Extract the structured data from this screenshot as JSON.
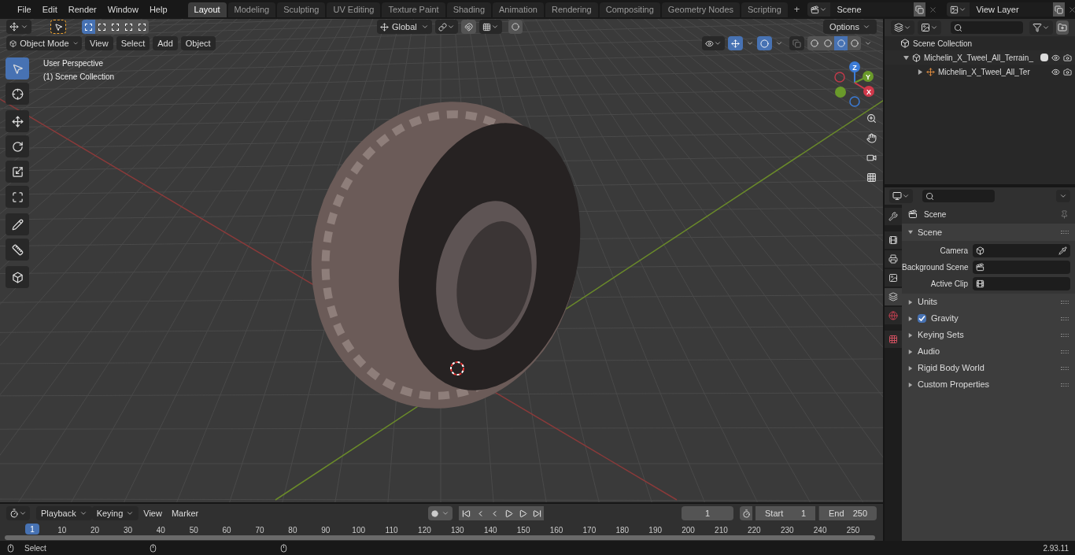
{
  "menu": [
    "File",
    "Edit",
    "Render",
    "Window",
    "Help"
  ],
  "workspaces": [
    {
      "label": "Layout",
      "selected": true
    },
    {
      "label": "Modeling",
      "selected": false
    },
    {
      "label": "Sculpting",
      "selected": false
    },
    {
      "label": "UV Editing",
      "selected": false
    },
    {
      "label": "Texture Paint",
      "selected": false
    },
    {
      "label": "Shading",
      "selected": false
    },
    {
      "label": "Animation",
      "selected": false
    },
    {
      "label": "Rendering",
      "selected": false
    },
    {
      "label": "Compositing",
      "selected": false
    },
    {
      "label": "Geometry Nodes",
      "selected": false
    },
    {
      "label": "Scripting",
      "selected": false
    }
  ],
  "add_workspace": "+",
  "scene": {
    "value": "Scene"
  },
  "view_layer": {
    "value": "View Layer"
  },
  "viewport": {
    "mode": "Object Mode",
    "menus": [
      "View",
      "Select",
      "Add",
      "Object"
    ],
    "orientation": "Global",
    "options": "Options",
    "overlay_text": [
      "User Perspective",
      "(1) Scene Collection"
    ],
    "tools": [
      {
        "selected": true
      },
      {
        "selected": false
      },
      {
        "selected": false
      },
      {
        "selected": false
      },
      {
        "selected": false
      },
      {
        "selected": false
      },
      {
        "selected": false
      },
      {
        "selected": false
      },
      {
        "selected": false
      }
    ],
    "gizmo": {
      "z": "Z",
      "y": "Y",
      "x": "X"
    },
    "shading": [
      {
        "selected": false
      },
      {
        "selected": false
      },
      {
        "selected": true
      },
      {
        "selected": false
      }
    ]
  },
  "outliner": {
    "root": "Scene Collection",
    "children": [
      {
        "name": "Michelin_X_Tweel_All_Terrain_",
        "expanded": true,
        "checked": true,
        "children": [
          {
            "name": "Michelin_X_Tweel_All_Ter",
            "expanded": false
          }
        ]
      }
    ]
  },
  "properties": {
    "tabs": [
      {
        "selected": false
      },
      {
        "selected": false
      },
      {
        "selected": false
      },
      {
        "selected": false
      },
      {
        "selected": true
      },
      {
        "selected": false
      },
      {
        "selected": false
      }
    ],
    "title": "Scene",
    "panel": {
      "label": "Scene",
      "expanded": true,
      "fields": [
        {
          "label": "Camera"
        },
        {
          "label": "Background Scene"
        },
        {
          "label": "Active Clip"
        }
      ]
    },
    "subpanels": [
      {
        "kind": "plain",
        "label": "Units",
        "expanded": false
      },
      {
        "kind": "checkbox",
        "label": "Gravity",
        "checked": true,
        "expanded": false
      },
      {
        "kind": "plain",
        "label": "Keying Sets",
        "expanded": false
      },
      {
        "kind": "plain",
        "label": "Audio",
        "expanded": false
      },
      {
        "kind": "plain",
        "label": "Rigid Body World",
        "expanded": false
      },
      {
        "kind": "plain",
        "label": "Custom Properties",
        "expanded": false
      }
    ]
  },
  "timeline": {
    "menus": [
      {
        "label": "Playback",
        "dropdown": true
      },
      {
        "label": "Keying",
        "dropdown": true
      },
      {
        "label": "View",
        "dropdown": false
      },
      {
        "label": "Marker",
        "dropdown": false
      }
    ],
    "current_frame": "1",
    "start_label": "Start",
    "start": "1",
    "end_label": "End",
    "end": "250",
    "ruler": [
      "1",
      "10",
      "20",
      "30",
      "40",
      "50",
      "60",
      "70",
      "80",
      "90",
      "100",
      "110",
      "120",
      "130",
      "140",
      "150",
      "160",
      "170",
      "180",
      "190",
      "200",
      "210",
      "220",
      "230",
      "240",
      "250"
    ]
  },
  "status_bar": {
    "left": "Select",
    "version": "2.93.11"
  }
}
